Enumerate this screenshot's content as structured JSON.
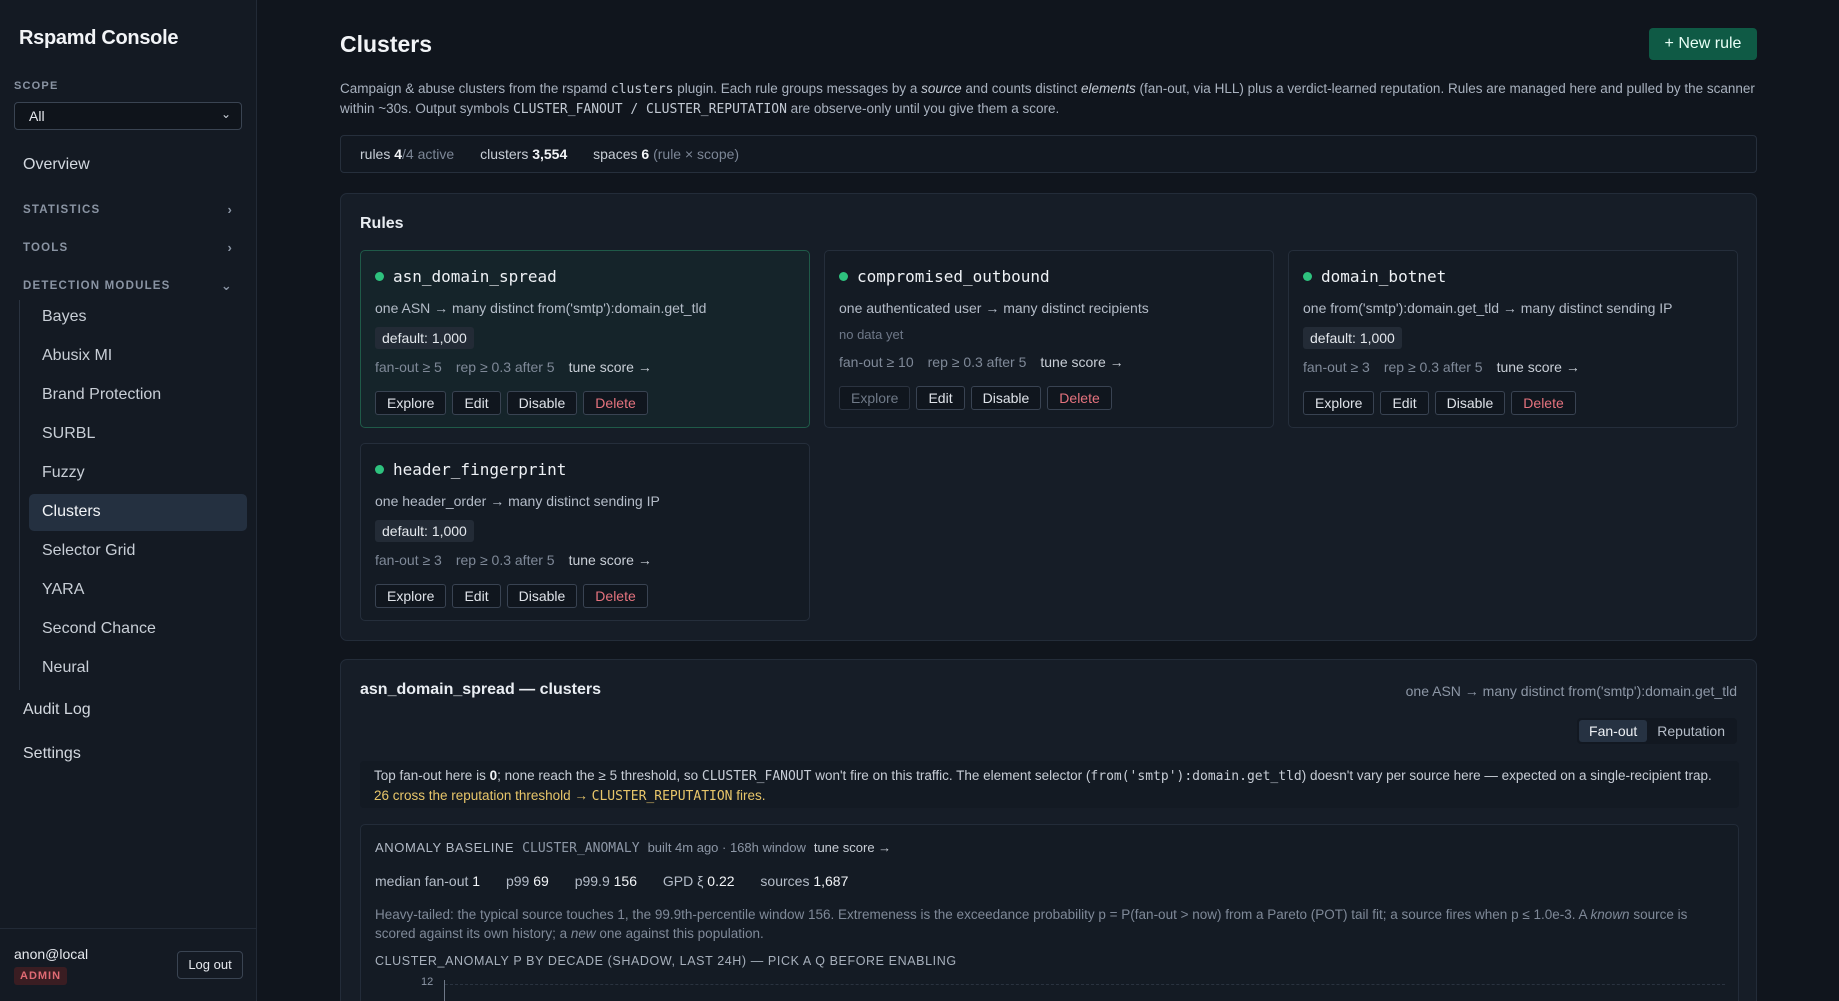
{
  "app": {
    "title": "Rspamd Console"
  },
  "sidebar": {
    "scope_label": "SCOPE",
    "scope_value": "All",
    "overview": "Overview",
    "sections": [
      {
        "label": "STATISTICS",
        "state": "collapsed"
      },
      {
        "label": "TOOLS",
        "state": "collapsed"
      },
      {
        "label": "DETECTION MODULES",
        "state": "expanded"
      }
    ],
    "modules": [
      "Bayes",
      "Abusix MI",
      "Brand Protection",
      "SURBL",
      "Fuzzy",
      "Clusters",
      "Selector Grid",
      "YARA",
      "Second Chance",
      "Neural"
    ],
    "active_module": "Clusters",
    "audit_log": "Audit Log",
    "settings": "Settings",
    "user": "anon@local",
    "role": "ADMIN",
    "logout": "Log out"
  },
  "page": {
    "title": "Clusters",
    "new_rule": "+ New rule",
    "intro": {
      "p1": "Campaign & abuse clusters from the rspamd ",
      "code1": "clusters",
      "p2": " plugin. Each rule groups messages by a ",
      "em1": "source",
      "p3": " and counts distinct ",
      "em2": "elements",
      "p4": " (fan-out, via HLL) plus a verdict-learned reputation. Rules are managed here and pulled by the scanner within ~30s. Output symbols ",
      "code2": "CLUSTER_FANOUT / CLUSTER_REPUTATION",
      "p5": " are observe-only until you give them a score."
    },
    "stats": {
      "rules_label": "rules",
      "rules_value": "4",
      "rules_suffix": "/4 active",
      "clusters_label": "clusters",
      "clusters_value": "3,554",
      "spaces_label": "spaces",
      "spaces_value": "6",
      "spaces_suffix": "(rule × scope)"
    }
  },
  "rules_panel": {
    "title": "Rules",
    "tune_label": "tune score →",
    "actions": {
      "explore": "Explore",
      "edit": "Edit",
      "disable": "Disable",
      "delete": "Delete"
    },
    "rules": [
      {
        "name": "asn_domain_spread",
        "desc": "one ASN → many distinct from('smtp'):domain.get_tld",
        "default": "default: 1,000",
        "fanout": "fan-out ≥ 5",
        "rep": "rep ≥ 0.3 after 5",
        "selected": true
      },
      {
        "name": "compromised_outbound",
        "desc": "one authenticated user → many distinct recipients",
        "nodata": "no data yet",
        "fanout": "fan-out ≥ 10",
        "rep": "rep ≥ 0.3 after 5"
      },
      {
        "name": "domain_botnet",
        "desc": "one from('smtp'):domain.get_tld → many distinct sending IP",
        "default": "default: 1,000",
        "fanout": "fan-out ≥ 3",
        "rep": "rep ≥ 0.3 after 5"
      },
      {
        "name": "header_fingerprint",
        "desc": "one header_order → many distinct sending IP",
        "default": "default: 1,000",
        "fanout": "fan-out ≥ 3",
        "rep": "rep ≥ 0.3 after 5"
      }
    ]
  },
  "clusters_panel": {
    "title": "asn_domain_spread — clusters",
    "subtitle": "one ASN → many distinct from('smtp'):domain.get_tld",
    "tabs": [
      "Fan-out",
      "Reputation"
    ],
    "active_tab": "Fan-out",
    "notice": {
      "t1": "Top fan-out here is ",
      "b1": "0",
      "t2": "; none reach the ≥ 5 threshold, so ",
      "c1": "CLUSTER_FANOUT",
      "t3": " won't fire on this traffic. The element selector (",
      "c2": "from('smtp'):domain.get_tld",
      "t4": ") doesn't vary per source here — expected on a single-recipient trap. ",
      "warn1": "26 cross the reputation threshold → ",
      "warn_code": "CLUSTER_REPUTATION",
      "warn2": " fires."
    },
    "anomaly": {
      "label": "ANOMALY BASELINE",
      "symbol": "CLUSTER_ANOMALY",
      "built": "built 4m ago · 168h window",
      "tune": "tune score →",
      "median_label": "median fan-out",
      "median": "1",
      "p99_label": "p99",
      "p99": "69",
      "p999_label": "p99.9",
      "p999": "156",
      "gpd_label": "GPD ξ",
      "gpd": "0.22",
      "sources_label": "sources",
      "sources": "1,687",
      "d1": "Heavy-tailed: the typical source touches 1, the 99.9th-percentile window 156. Extremeness is the exceedance probability p = P(fan-out > now) from a Pareto (POT) tail fit; a source fires when p ≤ 1.0e-3. A ",
      "d_em1": "known",
      "d2": " source is scored against its own history; a ",
      "d_em2": "new",
      "d3": " one against this population.",
      "chart_title": "CLUSTER_ANOMALY P BY DECADE (SHADOW, LAST 24H) — PICK A Q BEFORE ENABLING",
      "y_tick": "12"
    }
  },
  "colors": {
    "accent_green": "#2ec27e",
    "primary_button": "#0f5a45",
    "danger": "#e5737e",
    "warning": "#e8c66a"
  }
}
